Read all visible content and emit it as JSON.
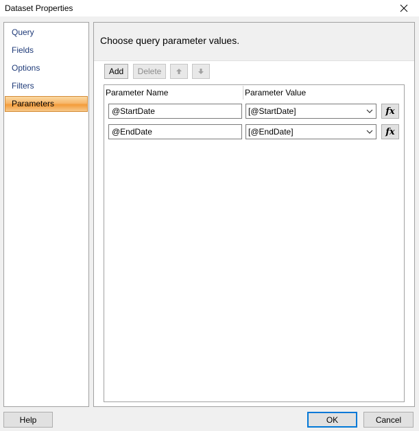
{
  "window": {
    "title": "Dataset Properties"
  },
  "nav": {
    "items": [
      {
        "label": "Query"
      },
      {
        "label": "Fields"
      },
      {
        "label": "Options"
      },
      {
        "label": "Filters"
      },
      {
        "label": "Parameters",
        "selected": true
      }
    ]
  },
  "content": {
    "heading": "Choose query parameter values.",
    "toolbar": {
      "add_label": "Add",
      "delete_label": "Delete"
    },
    "grid": {
      "headers": {
        "name": "Parameter Name",
        "value": "Parameter Value"
      },
      "rows": [
        {
          "name": "@StartDate",
          "value": "[@StartDate]"
        },
        {
          "name": "@EndDate",
          "value": "[@EndDate]"
        }
      ]
    }
  },
  "footer": {
    "help_label": "Help",
    "ok_label": "OK",
    "cancel_label": "Cancel"
  },
  "colors": {
    "selected_nav_bg": "#f7b76b",
    "nav_text": "#1e3a78",
    "default_button_border": "#0078d7"
  },
  "icons": {
    "close": "close-icon",
    "move_up": "arrow-up-icon",
    "move_down": "arrow-down-icon",
    "dropdown": "chevron-down-icon",
    "expression": "function-fx-icon"
  }
}
